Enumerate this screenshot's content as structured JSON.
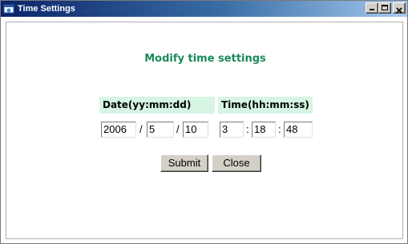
{
  "window": {
    "title": "Time Settings"
  },
  "page": {
    "heading": "Modify time settings",
    "date_header": "Date(yy:mm:dd)",
    "time_header": "Time(hh:mm:ss)",
    "date": {
      "year": "2006",
      "month": "5",
      "day": "10",
      "separator": "/"
    },
    "time": {
      "hour": "3",
      "minute": "18",
      "second": "48",
      "separator": ":"
    },
    "buttons": {
      "submit": "Submit",
      "close": "Close"
    }
  },
  "colors": {
    "heading": "#1a8a5a",
    "header_bg": "#d6f5e3",
    "titlebar_start": "#0a246a",
    "titlebar_end": "#a6caf0"
  }
}
